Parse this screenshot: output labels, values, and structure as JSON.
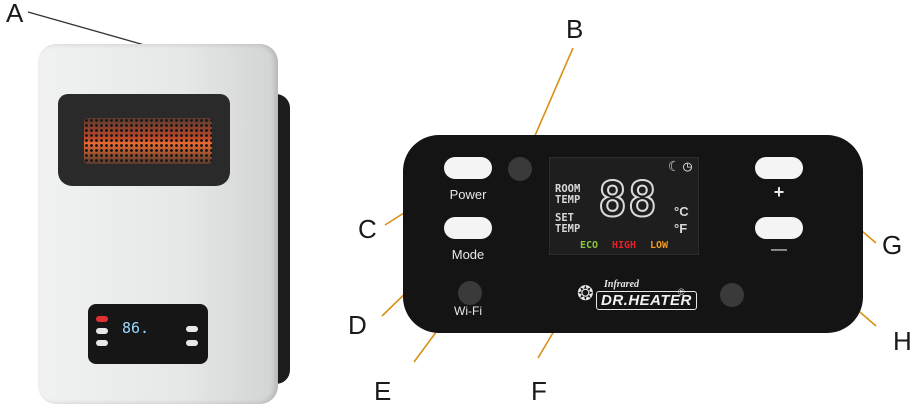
{
  "callouts": {
    "a": "A",
    "b": "B",
    "c": "C",
    "d": "D",
    "e": "E",
    "f": "F",
    "g": "G",
    "h": "H"
  },
  "panel": {
    "power_label": "Power",
    "mode_label": "Mode",
    "wifi_label": "Wi-Fi",
    "plus_label": "+",
    "minus_label": "—",
    "room_temp_label_1": "ROOM",
    "room_temp_label_2": "TEMP",
    "set_temp_label_1": "SET",
    "set_temp_label_2": "TEMP",
    "digits": "88",
    "unit_c": "°C",
    "unit_f": "°F",
    "mode_eco": "ECO",
    "mode_high": "HIGH",
    "mode_low": "LOW",
    "brand_small": "Infrared",
    "brand_big": "DR.HEATER",
    "registered": "®",
    "moon_icon": "☾",
    "timer_icon": "◷",
    "leaf_icon": "❂"
  },
  "heater": {
    "mini_display": "86."
  },
  "colors": {
    "eco": "#8cc63f",
    "high": "#e8202a",
    "low": "#f39a1e"
  }
}
